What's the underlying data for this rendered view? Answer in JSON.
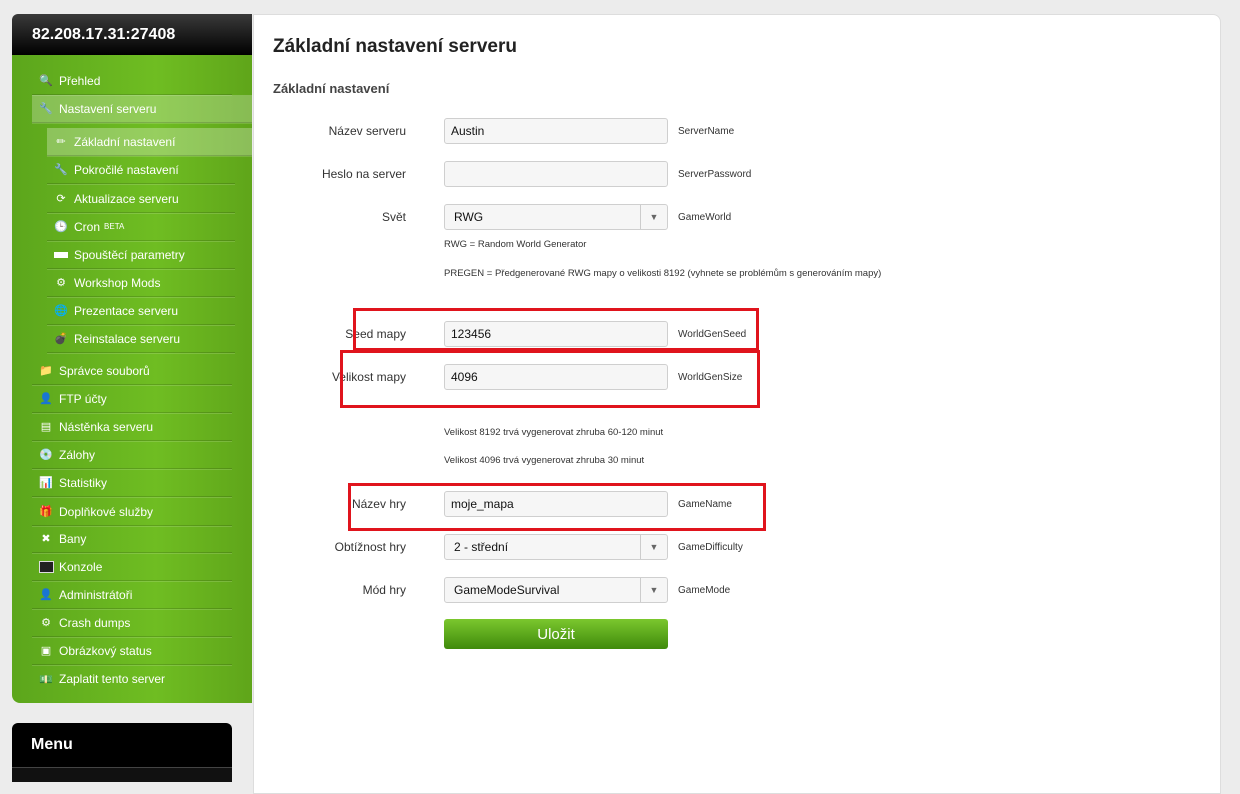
{
  "server_address": "82.208.17.31:27408",
  "sidebar": {
    "items": [
      {
        "label": "Přehled",
        "icon": "magnifier-icon"
      },
      {
        "label": "Nastavení serveru",
        "icon": "wrench-icon"
      },
      {
        "label": "Základní nastavení",
        "icon": "pencil-icon"
      },
      {
        "label": "Pokročilé nastavení",
        "icon": "wrench-icon"
      },
      {
        "label": "Aktualizace serveru",
        "icon": "refresh-icon"
      },
      {
        "label": "Cron",
        "badge": "BETA",
        "icon": "clock-icon"
      },
      {
        "label": "Spouštěcí parametry",
        "icon": "window-icon"
      },
      {
        "label": "Workshop Mods",
        "icon": "steam-icon"
      },
      {
        "label": "Prezentace serveru",
        "icon": "globe-icon"
      },
      {
        "label": "Reinstalace serveru",
        "icon": "bomb-icon"
      },
      {
        "label": "Správce souborů",
        "icon": "folder-icon"
      },
      {
        "label": "FTP účty",
        "icon": "ftp-user-icon"
      },
      {
        "label": "Nástěnka serveru",
        "icon": "board-icon"
      },
      {
        "label": "Zálohy",
        "icon": "disc-icon"
      },
      {
        "label": "Statistiky",
        "icon": "bar-chart-icon"
      },
      {
        "label": "Doplňkové služby",
        "icon": "gift-icon"
      },
      {
        "label": "Bany",
        "icon": "ban-icon"
      },
      {
        "label": "Konzole",
        "icon": "terminal-icon"
      },
      {
        "label": "Administrátoři",
        "icon": "admin-icon"
      },
      {
        "label": "Crash dumps",
        "icon": "gear-icon"
      },
      {
        "label": "Obrázkový status",
        "icon": "image-icon"
      },
      {
        "label": "Zaplatit tento server",
        "icon": "money-icon"
      }
    ]
  },
  "menu": {
    "title": "Menu"
  },
  "main": {
    "title": "Základní nastavení serveru",
    "section": "Základní nastavení",
    "fields": {
      "server_name": {
        "label": "Název serveru",
        "value": "Austin",
        "key": "ServerName"
      },
      "server_password": {
        "label": "Heslo na server",
        "value": "",
        "key": "ServerPassword"
      },
      "world": {
        "label": "Svět",
        "value": "RWG",
        "key": "GameWorld"
      },
      "seed": {
        "label": "Seed mapy",
        "value": "123456",
        "key": "WorldGenSeed"
      },
      "size": {
        "label": "Velikost mapy",
        "value": "4096",
        "key": "WorldGenSize"
      },
      "game_name": {
        "label": "Název hry",
        "value": "moje_mapa",
        "key": "GameName"
      },
      "difficulty": {
        "label": "Obtížnost hry",
        "value": "2 - střední",
        "key": "GameDifficulty"
      },
      "mode": {
        "label": "Mód hry",
        "value": "GameModeSurvival",
        "key": "GameMode"
      }
    },
    "notes": {
      "rwg": "RWG = Random World Generator",
      "pregen": "PREGEN = Předgenerované RWG mapy o velikosti 8192 (vyhnete se problémům s generováním mapy)",
      "size_8192": "Velikost 8192 trvá vygenerovat zhruba 60-120 minut",
      "size_4096": "Velikost 4096 trvá vygenerovat zhruba 30 minut"
    },
    "save_label": "Uložit"
  },
  "colors": {
    "sidebar_green": "#6fbd22",
    "highlight_red": "#e0141d",
    "button_green": "#5aa61a"
  }
}
